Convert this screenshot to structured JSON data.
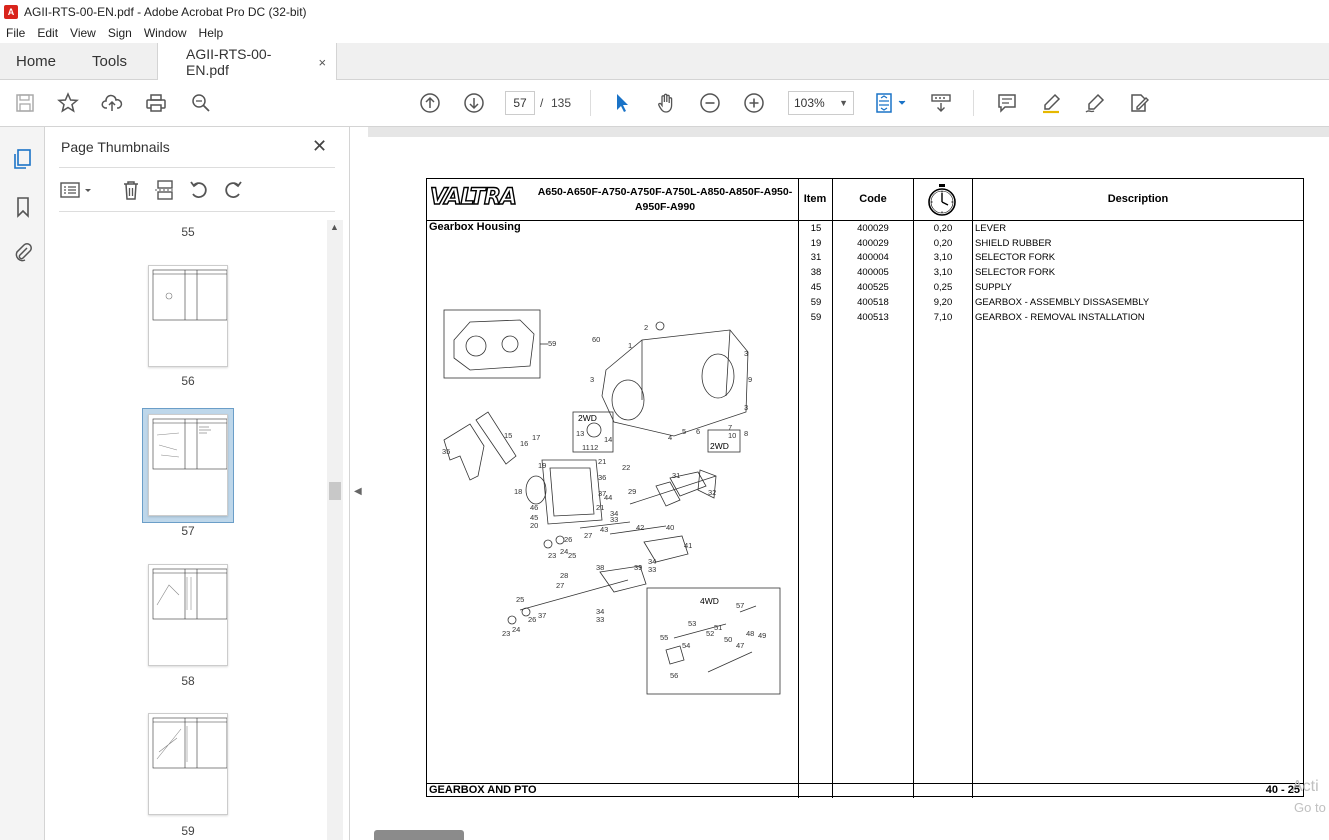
{
  "window": {
    "title": "AGII-RTS-00-EN.pdf - Adobe Acrobat Pro DC (32-bit)",
    "app_icon": "acrobat-icon"
  },
  "menu": [
    "File",
    "Edit",
    "View",
    "Sign",
    "Window",
    "Help"
  ],
  "tabs": {
    "home": "Home",
    "tools": "Tools",
    "document": "AGII-RTS-00-EN.pdf",
    "close_glyph": "×"
  },
  "toolbar": {
    "current_page": "57",
    "separator": "/",
    "total_pages": "135",
    "zoom": "103%"
  },
  "thumbnails_panel": {
    "title": "Page Thumbnails",
    "close_glyph": "✕",
    "pages": [
      {
        "label": "55"
      },
      {
        "label": "56"
      },
      {
        "label": "57",
        "selected": true
      },
      {
        "label": "58"
      },
      {
        "label": "59"
      }
    ]
  },
  "sheet": {
    "brand": "VALTRA",
    "models": "A650-A650F-A750-A750F-A750L-A850-A850F-A950-A950F-A990",
    "headers": {
      "item": "Item",
      "code": "Code",
      "time_icon": "stopwatch-icon",
      "description": "Description"
    },
    "section_title": "Gearbox Housing",
    "rows": [
      {
        "item": "15",
        "code": "400029",
        "time": "0,20",
        "description": "LEVER"
      },
      {
        "item": "19",
        "code": "400029",
        "time": "0,20",
        "description": "SHIELD RUBBER"
      },
      {
        "item": "31",
        "code": "400004",
        "time": "3,10",
        "description": "SELECTOR FORK"
      },
      {
        "item": "38",
        "code": "400005",
        "time": "3,10",
        "description": "SELECTOR FORK"
      },
      {
        "item": "45",
        "code": "400525",
        "time": "0,25",
        "description": "SUPPLY"
      },
      {
        "item": "59",
        "code": "400518",
        "time": "9,20",
        "description": "GEARBOX - ASSEMBLY DISSASEMBLY"
      },
      {
        "item": "59",
        "code": "400513",
        "time": "7,10",
        "description": "GEARBOX - REMOVAL INSTALLATION"
      }
    ],
    "footer_left": "GEARBOX AND PTO",
    "footer_right": "40 - 25",
    "drawing_labels": {
      "twowd_a": "2WD",
      "twowd_b": "2WD",
      "fourwd": "4WD"
    }
  },
  "watermark": {
    "line1": "Acti",
    "line2": "Go to"
  }
}
